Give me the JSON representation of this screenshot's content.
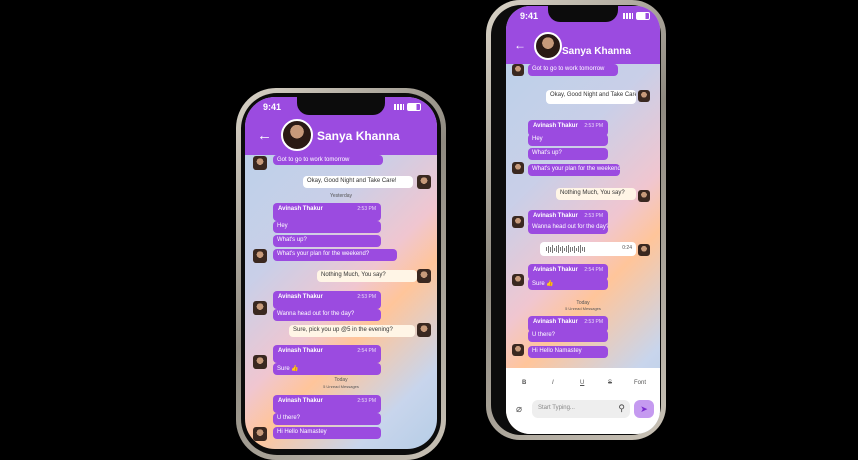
{
  "phone1": {
    "time": "9:41",
    "contact_name": "Sanya Khanna",
    "messages": {
      "m0": "Got to go to work tomorrow",
      "m1": "Okay, Good Night and Take Care!",
      "date1": "Yesterday",
      "c1_sender": "Avinash Thakur",
      "c1_time": "2:53 PM",
      "m2": "Hey",
      "m3": "What's up?",
      "m4": "What's your plan for the weekend?",
      "m5": "Nothing Much, You say?",
      "c2_sender": "Avinash Thakur",
      "c2_time": "2:53 PM",
      "m6": "Wanna head out for the day?",
      "m7": "Sure, pick you up @5 in the evening?",
      "c3_sender": "Avinash Thakur",
      "c3_time": "2:54 PM",
      "m8": "Sure 👍",
      "date2": "Today",
      "date2_sub": "5 Unread Messages",
      "c4_sender": "Avinash Thakur",
      "c4_time": "2:53 PM",
      "m9": "U there?",
      "m10": "Hi Hello Namastey"
    }
  },
  "phone2": {
    "time": "9:41",
    "contact_name": "Sanya Khanna",
    "messages": {
      "m0": "Got to go to work tomorrow",
      "m1": "Okay, Good Night and Take Care!",
      "c1_sender": "Avinash Thakur",
      "c1_time": "2:53 PM",
      "m2": "Hey",
      "m3": "What's up?",
      "m4": "What's your plan for the weekend?",
      "m5": "Nothing Much, You say?",
      "c2_sender": "Avinash Thakur",
      "c2_time": "2:53 PM",
      "m6": "Wanna head out for the day?",
      "audio_time": "0:24",
      "c3_sender": "Avinash Thakur",
      "c3_time": "2:54 PM",
      "m8": "Sure 👍",
      "date2": "Today",
      "date2_sub": "5 Unread Messages",
      "c4_sender": "Avinash Thakur",
      "c4_time": "2:53 PM",
      "m9": "U there?",
      "m10": "Hi Hello Namastey"
    },
    "format": {
      "b": "B",
      "i": "I",
      "u": "U",
      "s": "S",
      "font": "Font"
    },
    "input_placeholder": "Start Typing..."
  },
  "colors": {
    "accent": "#9b4be0",
    "background": "#000000"
  },
  "icons": {
    "back": "arrow-left-icon",
    "send": "send-icon",
    "attach": "paperclip-icon",
    "mic": "microphone-icon"
  }
}
